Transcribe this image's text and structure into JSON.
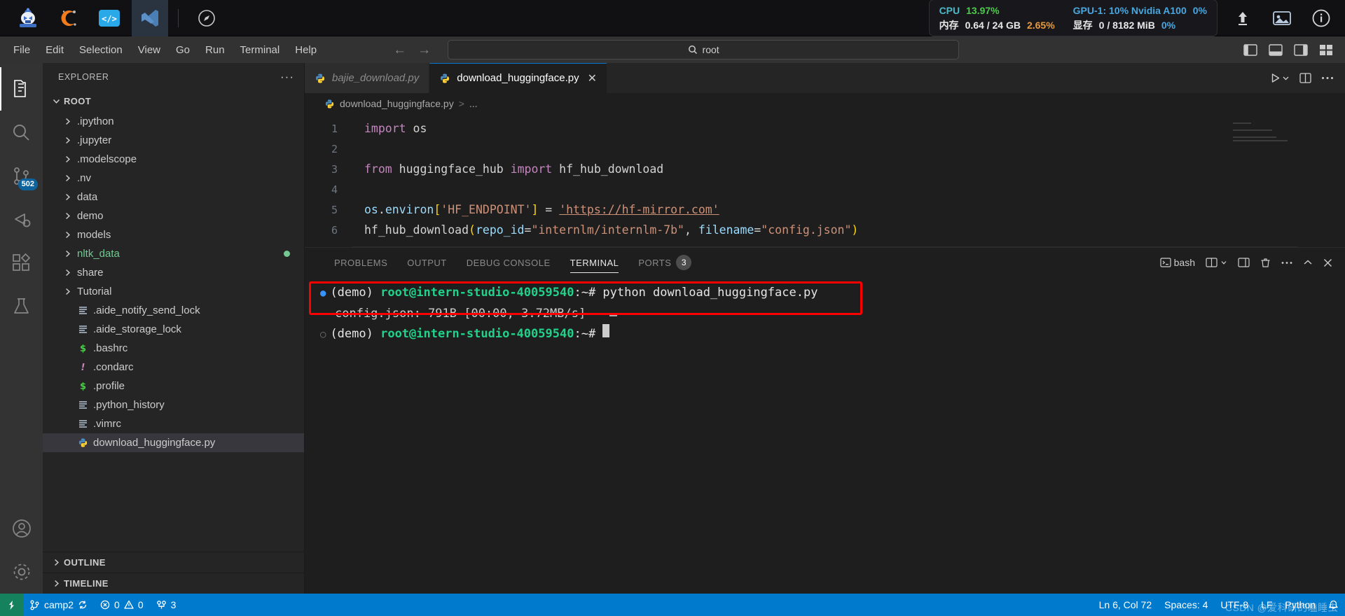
{
  "hostbar": {
    "apps": [
      {
        "name": "intern-studio-logo",
        "label": ""
      },
      {
        "name": "conda-logo",
        "label": ""
      },
      {
        "name": "code-server-logo",
        "label": ""
      },
      {
        "name": "vscode-logo",
        "label": ""
      }
    ],
    "compass_icon": "compass-icon",
    "stats": {
      "cpu_label": "CPU",
      "cpu_value": "13.97%",
      "mem_label": "内存",
      "mem_value": "0.64 / 24 GB",
      "mem_percent": "2.65%",
      "gpu_label": "GPU-1: 10% Nvidia A100",
      "gpu_percent": "0%",
      "vram_label": "显存",
      "vram_value": "0 / 8182 MiB",
      "vram_percent": "0%"
    },
    "right_icons": [
      "upload-icon",
      "image-icon",
      "info-icon"
    ]
  },
  "menubar": {
    "items": [
      "File",
      "Edit",
      "Selection",
      "View",
      "Go",
      "Run",
      "Terminal",
      "Help"
    ],
    "back_arrow": "←",
    "forward_arrow": "→",
    "command_bar": {
      "search_icon": "search-icon",
      "text": "root"
    },
    "layout_icons": [
      "toggle-primary-sidebar-icon",
      "toggle-panel-icon",
      "toggle-secondary-sidebar-icon",
      "customize-layout-icon"
    ]
  },
  "activitybar": {
    "items": [
      {
        "name": "explorer",
        "icon": "files-icon",
        "active": true,
        "badge": ""
      },
      {
        "name": "search",
        "icon": "search-icon",
        "active": false,
        "badge": ""
      },
      {
        "name": "source-control",
        "icon": "source-control-icon",
        "active": false,
        "badge": "502"
      },
      {
        "name": "run-and-debug",
        "icon": "debug-icon",
        "active": false,
        "badge": ""
      },
      {
        "name": "extensions",
        "icon": "extensions-icon",
        "active": false,
        "badge": ""
      },
      {
        "name": "testing",
        "icon": "beaker-icon",
        "active": false,
        "badge": ""
      }
    ],
    "bottom": [
      {
        "name": "accounts",
        "icon": "account-icon"
      },
      {
        "name": "settings",
        "icon": "gear-icon"
      }
    ]
  },
  "sidebar": {
    "title": "EXPLORER",
    "more_actions": "···",
    "root_label": "ROOT",
    "tree": [
      {
        "label": ".ipython",
        "type": "folder",
        "color": "#cccccc",
        "selected": false,
        "marker": ""
      },
      {
        "label": ".jupyter",
        "type": "folder",
        "color": "#cccccc",
        "selected": false,
        "marker": ""
      },
      {
        "label": ".modelscope",
        "type": "folder",
        "color": "#cccccc",
        "selected": false,
        "marker": ""
      },
      {
        "label": ".nv",
        "type": "folder",
        "color": "#cccccc",
        "selected": false,
        "marker": ""
      },
      {
        "label": "data",
        "type": "folder",
        "color": "#cccccc",
        "selected": false,
        "marker": ""
      },
      {
        "label": "demo",
        "type": "folder",
        "color": "#cccccc",
        "selected": false,
        "marker": ""
      },
      {
        "label": "models",
        "type": "folder",
        "color": "#cccccc",
        "selected": false,
        "marker": ""
      },
      {
        "label": "nltk_data",
        "type": "folder",
        "color": "#73c991",
        "selected": false,
        "marker": "#73c991"
      },
      {
        "label": "share",
        "type": "folder",
        "color": "#cccccc",
        "selected": false,
        "marker": ""
      },
      {
        "label": "Tutorial",
        "type": "folder",
        "color": "#cccccc",
        "selected": false,
        "marker": ""
      },
      {
        "label": ".aide_notify_send_lock",
        "type": "file",
        "color": "#cccccc",
        "selected": false,
        "marker": "",
        "icon": "text-file-icon"
      },
      {
        "label": ".aide_storage_lock",
        "type": "file",
        "color": "#cccccc",
        "selected": false,
        "marker": "",
        "icon": "text-file-icon"
      },
      {
        "label": ".bashrc",
        "type": "file",
        "color": "#cccccc",
        "selected": false,
        "marker": "",
        "icon": "shell-file-icon"
      },
      {
        "label": ".condarc",
        "type": "file",
        "color": "#cccccc",
        "selected": false,
        "marker": "",
        "icon": "config-file-icon"
      },
      {
        "label": ".profile",
        "type": "file",
        "color": "#cccccc",
        "selected": false,
        "marker": "",
        "icon": "shell-file-icon"
      },
      {
        "label": ".python_history",
        "type": "file",
        "color": "#cccccc",
        "selected": false,
        "marker": "",
        "icon": "text-file-icon"
      },
      {
        "label": ".vimrc",
        "type": "file",
        "color": "#cccccc",
        "selected": false,
        "marker": "",
        "icon": "text-file-icon"
      },
      {
        "label": "download_huggingface.py",
        "type": "file",
        "color": "#cccccc",
        "selected": true,
        "marker": "",
        "icon": "python-file-icon"
      }
    ],
    "outline_label": "OUTLINE",
    "timeline_label": "TIMELINE"
  },
  "editor": {
    "tabs": [
      {
        "label": "bajie_download.py",
        "active": false,
        "icon": "python-file-icon",
        "closable": false
      },
      {
        "label": "download_huggingface.py",
        "active": true,
        "icon": "python-file-icon",
        "closable": true,
        "close": "✕"
      }
    ],
    "tab_actions": [
      "run-button",
      "run-dropdown-chevron",
      "split-editor-icon",
      "more-actions-icon"
    ],
    "breadcrumb": {
      "file": "download_huggingface.py",
      "separator": ">",
      "tail": "..."
    },
    "code": [
      {
        "num": "1",
        "tokens": [
          {
            "t": "import",
            "c": "k-kw"
          },
          {
            "t": " os",
            "c": "k-plain"
          }
        ]
      },
      {
        "num": "2",
        "tokens": []
      },
      {
        "num": "3",
        "tokens": [
          {
            "t": "from",
            "c": "k-kw"
          },
          {
            "t": " huggingface_hub ",
            "c": "k-plain"
          },
          {
            "t": "import",
            "c": "k-kw"
          },
          {
            "t": " hf_hub_download",
            "c": "k-plain"
          }
        ]
      },
      {
        "num": "4",
        "tokens": []
      },
      {
        "num": "5",
        "tokens": [
          {
            "t": "os",
            "c": "k-id"
          },
          {
            "t": ".",
            "c": "k-plain"
          },
          {
            "t": "environ",
            "c": "k-id"
          },
          {
            "t": "[",
            "c": "k-brk"
          },
          {
            "t": "'HF_ENDPOINT'",
            "c": "k-str"
          },
          {
            "t": "]",
            "c": "k-brk"
          },
          {
            "t": " = ",
            "c": "k-plain"
          },
          {
            "t": "'https://hf-mirror.com'",
            "c": "k-link"
          }
        ]
      },
      {
        "num": "6",
        "tokens": [
          {
            "t": "hf_hub_download",
            "c": "k-plain"
          },
          {
            "t": "(",
            "c": "k-brk"
          },
          {
            "t": "repo_id",
            "c": "k-param"
          },
          {
            "t": "=",
            "c": "k-plain"
          },
          {
            "t": "\"internlm/internlm-7b\"",
            "c": "k-str"
          },
          {
            "t": ", ",
            "c": "k-plain"
          },
          {
            "t": "filename",
            "c": "k-param"
          },
          {
            "t": "=",
            "c": "k-plain"
          },
          {
            "t": "\"config.json\"",
            "c": "k-str"
          },
          {
            "t": ")",
            "c": "k-brk"
          }
        ]
      }
    ]
  },
  "panel": {
    "tabs": [
      {
        "label": "PROBLEMS",
        "active": false,
        "badge": ""
      },
      {
        "label": "OUTPUT",
        "active": false,
        "badge": ""
      },
      {
        "label": "DEBUG CONSOLE",
        "active": false,
        "badge": ""
      },
      {
        "label": "TERMINAL",
        "active": true,
        "badge": ""
      },
      {
        "label": "PORTS",
        "active": false,
        "badge": "3"
      }
    ],
    "actions": {
      "shell_icon": "terminal-icon",
      "shell_name": "bash",
      "split_icon": "split-terminal-icon",
      "new_terminal_icon": "new-terminal-icon",
      "layout_icon": "terminal-layout-icon",
      "kill_icon": "trash-icon",
      "more_icon": "more-actions-icon",
      "chevron_up_icon": "chevron-up-icon",
      "close_icon": "close-icon"
    },
    "terminal": {
      "lines": [
        {
          "marker": "blue-dot",
          "segments": [
            {
              "t": "(demo) ",
              "c": "t-white"
            },
            {
              "t": "root@intern-studio-40059540",
              "c": "t-user"
            },
            {
              "t": ":",
              "c": "t-white"
            },
            {
              "t": "~",
              "c": "t-white"
            },
            {
              "t": "# python download_huggingface.py",
              "c": "t-white"
            }
          ]
        },
        {
          "marker": "",
          "segments": [
            {
              "t": "config.json: 791B [00:00, 3.72MB/s]",
              "c": "t-gray"
            }
          ]
        },
        {
          "marker": "gray-circle",
          "segments": [
            {
              "t": "(demo) ",
              "c": "t-white"
            },
            {
              "t": "root@intern-studio-40059540",
              "c": "t-user"
            },
            {
              "t": ":",
              "c": "t-white"
            },
            {
              "t": "~",
              "c": "t-white"
            },
            {
              "t": "# ",
              "c": "t-white"
            }
          ]
        }
      ],
      "highlight_color": "#fe0000"
    }
  },
  "statusbar": {
    "left": [
      {
        "name": "remote-indicator",
        "icon": "remote-icon",
        "label": ""
      },
      {
        "name": "branch",
        "icon": "git-branch-icon",
        "label": "camp2"
      },
      {
        "name": "sync",
        "icon": "sync-icon",
        "label": ""
      },
      {
        "name": "errors-warnings",
        "icon": "error-warning-icon",
        "label": "0  0"
      },
      {
        "name": "ports",
        "icon": "ports-icon",
        "label": "3"
      }
    ],
    "right": [
      {
        "name": "cursor-position",
        "label": "Ln 6, Col 72"
      },
      {
        "name": "indentation",
        "label": "Spaces: 4"
      },
      {
        "name": "encoding",
        "label": "UTF-8"
      },
      {
        "name": "eol",
        "label": "LF"
      },
      {
        "name": "language-mode",
        "label": "Python"
      },
      {
        "name": "bell",
        "label": ""
      }
    ],
    "errors_count": "0",
    "warnings_count": "0",
    "watermark": "CSDN @爱科研的瞌睡虫"
  }
}
